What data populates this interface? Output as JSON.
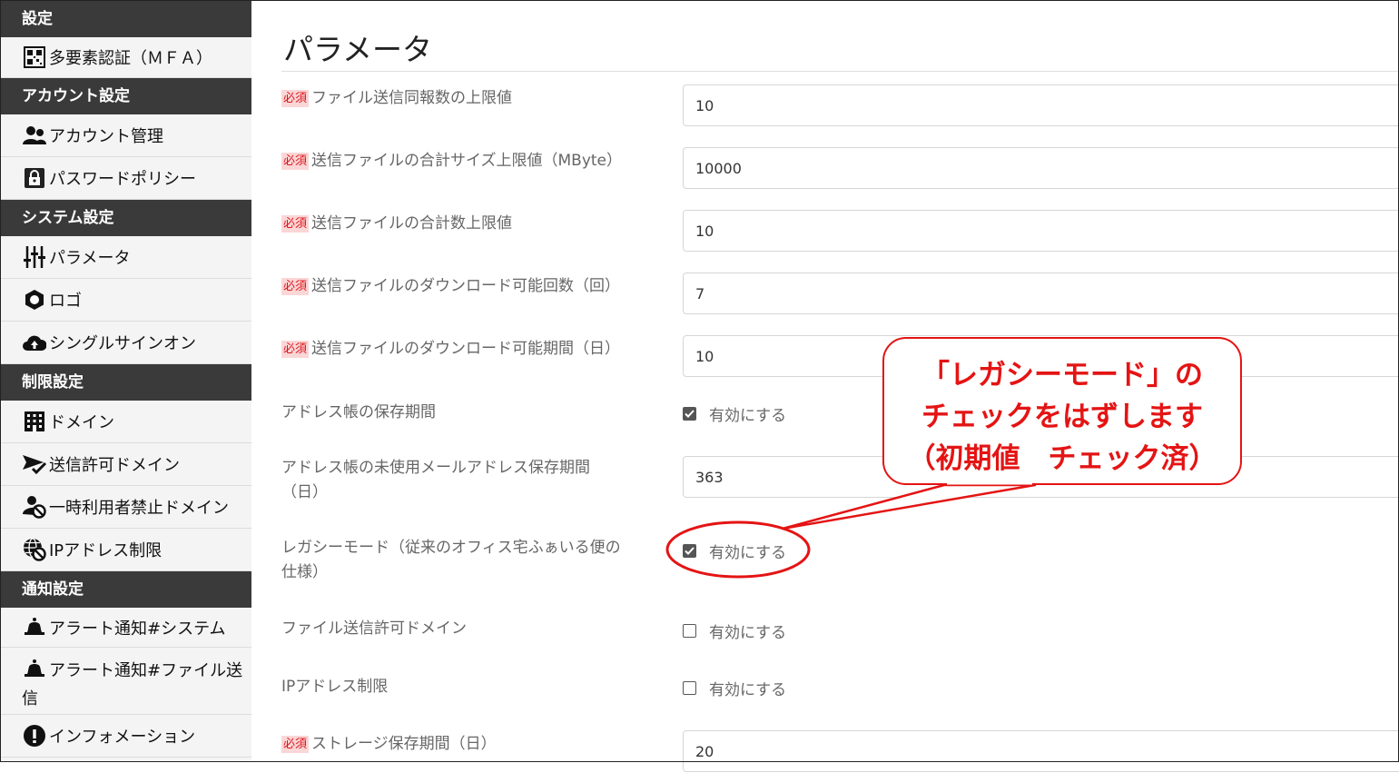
{
  "sidebar": {
    "sections": [
      {
        "title": "設定",
        "items": [
          {
            "label": "多要素認証（ＭＦＡ）",
            "icon": "qr-code-icon"
          }
        ]
      },
      {
        "title": "アカウント設定",
        "items": [
          {
            "label": "アカウント管理",
            "icon": "users-icon"
          },
          {
            "label": "パスワードポリシー",
            "icon": "lock-icon"
          }
        ]
      },
      {
        "title": "システム設定",
        "items": [
          {
            "label": "パラメータ",
            "icon": "sliders-icon"
          },
          {
            "label": "ロゴ",
            "icon": "hexagon-icon"
          },
          {
            "label": "シングルサインオン",
            "icon": "cloud-upload-icon"
          }
        ]
      },
      {
        "title": "制限設定",
        "items": [
          {
            "label": "ドメイン",
            "icon": "building-icon"
          },
          {
            "label": "送信許可ドメイン",
            "icon": "send-check-icon"
          },
          {
            "label": "一時利用者禁止ドメイン",
            "icon": "user-ban-icon"
          },
          {
            "label": "IPアドレス制限",
            "icon": "globe-ban-icon"
          }
        ]
      },
      {
        "title": "通知設定",
        "items": [
          {
            "label": "アラート通知#システム",
            "icon": "bell-icon"
          },
          {
            "label": "アラート通知#ファイル送信",
            "icon": "bell-icon"
          },
          {
            "label": "インフォメーション",
            "icon": "info-icon"
          }
        ]
      }
    ]
  },
  "main": {
    "title": "パラメータ",
    "required_badge": "必須",
    "checkbox_label": "有効にする",
    "rows": [
      {
        "label": "ファイル送信同報数の上限値",
        "required": true,
        "value": "10"
      },
      {
        "label": "送信ファイルの合計サイズ上限値（MByte）",
        "required": true,
        "value": "10000"
      },
      {
        "label": "送信ファイルの合計数上限値",
        "required": true,
        "value": "10"
      },
      {
        "label": "送信ファイルのダウンロード可能回数（回）",
        "required": true,
        "value": "7"
      },
      {
        "label": "送信ファイルのダウンロード可能期間（日）",
        "required": true,
        "value": "10"
      },
      {
        "label": "アドレス帳の保存期間",
        "required": false,
        "checked": true
      },
      {
        "label_line1": "アドレス帳の未使用メールアドレス保存期間",
        "label_line2": "（日）",
        "required": false,
        "value": "363"
      },
      {
        "label_line1": "レガシーモード（従来のオフィス宅ふぁいる便の",
        "label_line2": "仕様）",
        "required": false,
        "checked": true
      },
      {
        "label": "ファイル送信許可ドメイン",
        "required": false,
        "checked": false
      },
      {
        "label": "IPアドレス制限",
        "required": false,
        "checked": false
      },
      {
        "label": "ストレージ保存期間（日）",
        "required": true,
        "value": "20"
      }
    ]
  },
  "callout": {
    "line1": "「レガシーモード」の",
    "line2": "チェックをはずします",
    "line3": "（初期値　チェック済）",
    "color": "#e41414"
  }
}
